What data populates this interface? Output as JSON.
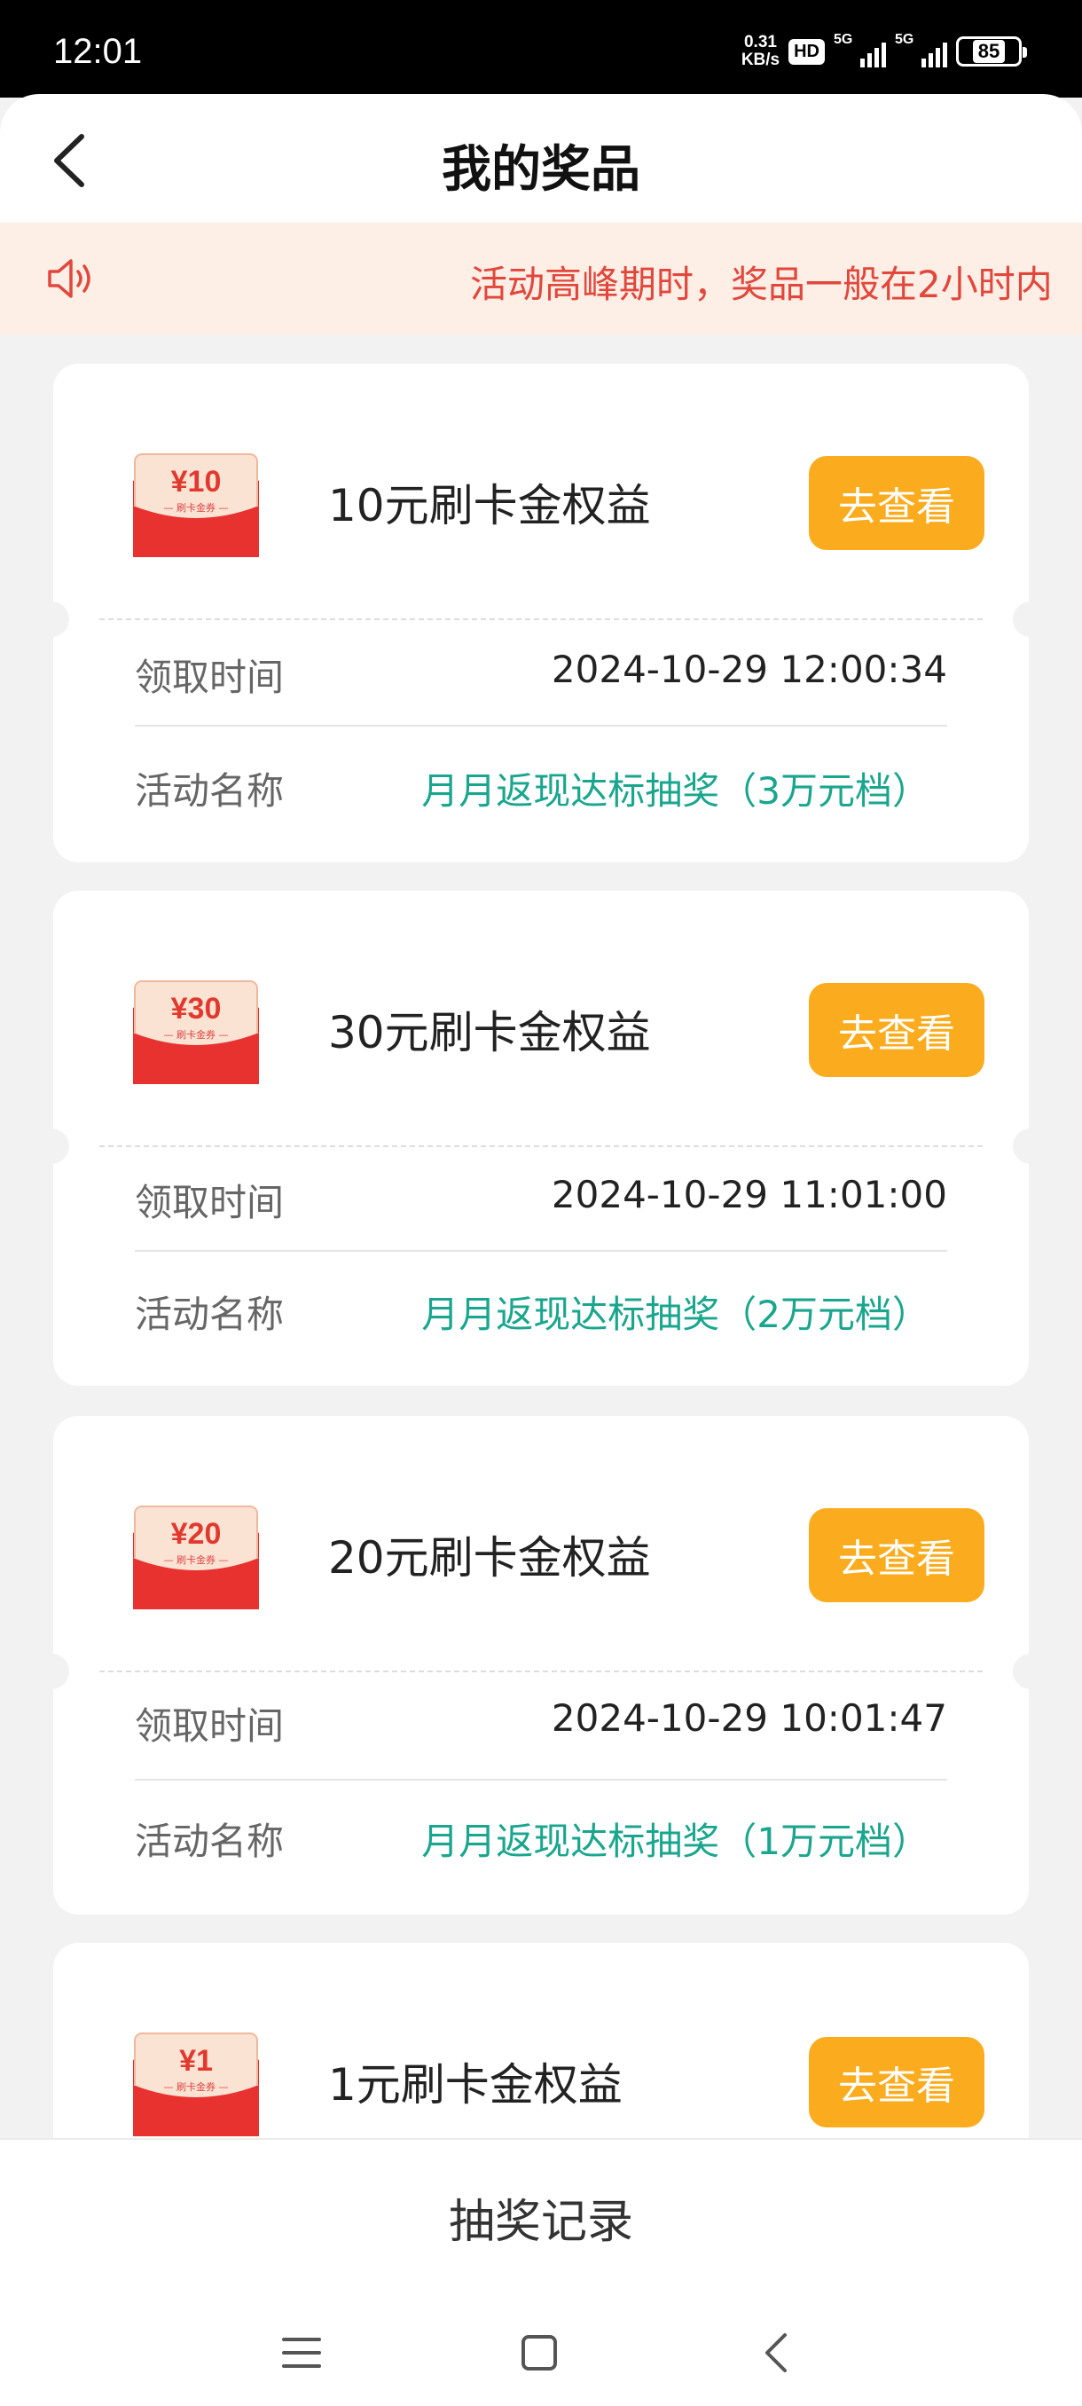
{
  "status_bar": {
    "time": "12:01",
    "net_speed_value": "0.31",
    "net_speed_unit": "KB/s",
    "hd_label": "HD",
    "signal1_label": "5G",
    "signal2_label": "5G",
    "battery": "85"
  },
  "header": {
    "title": "我的奖品",
    "back_icon": "chevron-left-icon"
  },
  "notice": {
    "icon": "speaker-icon",
    "text": "活动高峰期时，奖品一般在2小时内"
  },
  "prizes": [
    {
      "coupon_amount": "¥10",
      "coupon_caption": "— 刷卡金券 —",
      "name": "10元刷卡金权益",
      "button": "去查看",
      "time_label": "领取时间",
      "time_value": "2024-10-29 12:00:34",
      "activity_label": "活动名称",
      "activity_value": "月月返现达标抽奖（3万元档）"
    },
    {
      "coupon_amount": "¥30",
      "coupon_caption": "— 刷卡金券 —",
      "name": "30元刷卡金权益",
      "button": "去查看",
      "time_label": "领取时间",
      "time_value": "2024-10-29 11:01:00",
      "activity_label": "活动名称",
      "activity_value": "月月返现达标抽奖（2万元档）"
    },
    {
      "coupon_amount": "¥20",
      "coupon_caption": "— 刷卡金券 —",
      "name": "20元刷卡金权益",
      "button": "去查看",
      "time_label": "领取时间",
      "time_value": "2024-10-29 10:01:47",
      "activity_label": "活动名称",
      "activity_value": "月月返现达标抽奖（1万元档）"
    },
    {
      "coupon_amount": "¥1",
      "coupon_caption": "— 刷卡金券 —",
      "name": "1元刷卡金权益",
      "button": "去查看"
    }
  ],
  "footer": {
    "records_label": "抽奖记录"
  },
  "nav_bar": {
    "icons": [
      "menu-icon",
      "home-square-icon",
      "back-chevron-icon"
    ]
  },
  "colors": {
    "accent_button": "#fbac1e",
    "activity_text": "#1aa68e",
    "notice_text": "#e2473b",
    "notice_bg": "#fdeee6",
    "coupon_red": "#e02a2a"
  }
}
